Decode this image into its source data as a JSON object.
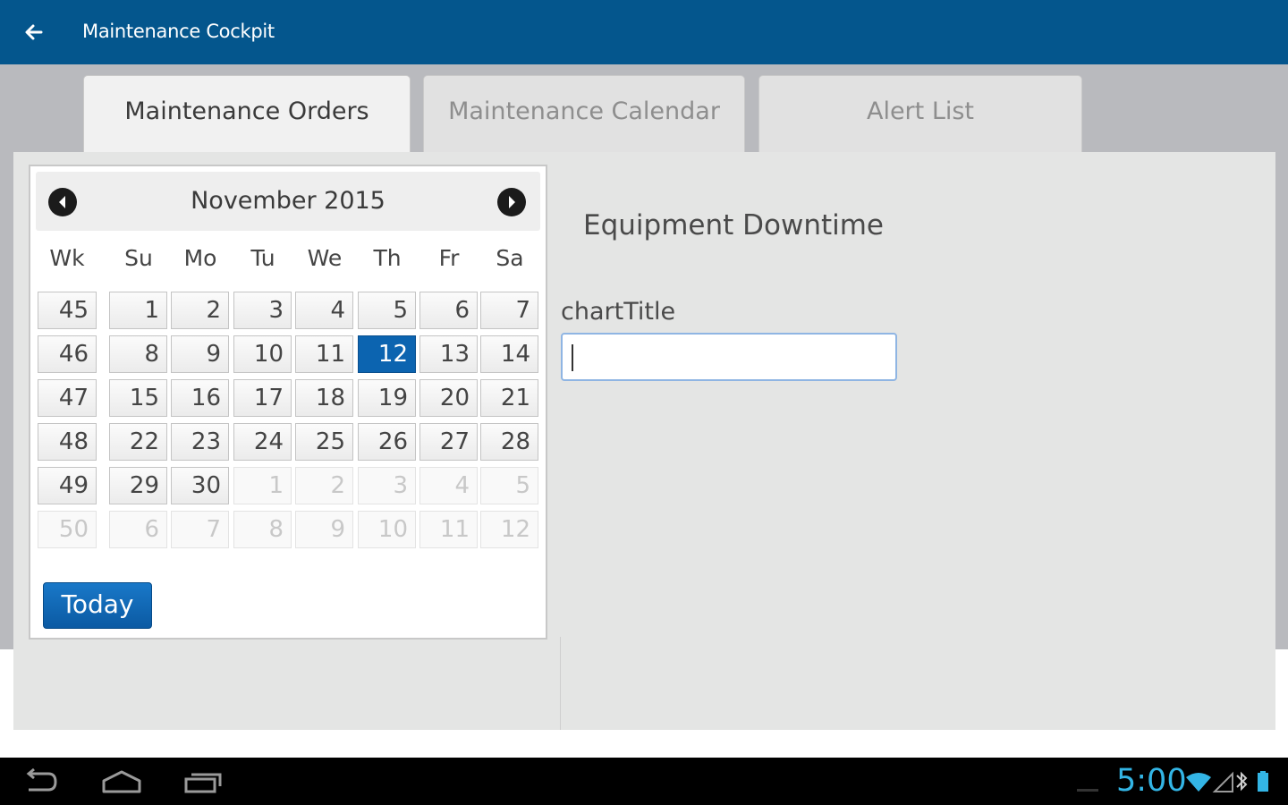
{
  "app": {
    "title": "Maintenance Cockpit"
  },
  "tabs": [
    {
      "label": "Maintenance Orders",
      "active": true
    },
    {
      "label": "Maintenance Calendar",
      "active": false
    },
    {
      "label": "Alert List",
      "active": false
    }
  ],
  "calendar": {
    "month_label": "November 2015",
    "weekdays": [
      "Wk",
      "Su",
      "Mo",
      "Tu",
      "We",
      "Th",
      "Fr",
      "Sa"
    ],
    "weeks": [
      {
        "wk": "45",
        "days": [
          "1",
          "2",
          "3",
          "4",
          "5",
          "6",
          "7"
        ]
      },
      {
        "wk": "46",
        "days": [
          "8",
          "9",
          "10",
          "11",
          "12",
          "13",
          "14"
        ]
      },
      {
        "wk": "47",
        "days": [
          "15",
          "16",
          "17",
          "18",
          "19",
          "20",
          "21"
        ]
      },
      {
        "wk": "48",
        "days": [
          "22",
          "23",
          "24",
          "25",
          "26",
          "27",
          "28"
        ]
      },
      {
        "wk": "49",
        "days": [
          "29",
          "30",
          "1",
          "2",
          "3",
          "4",
          "5"
        ]
      },
      {
        "wk": "50",
        "days": [
          "6",
          "7",
          "8",
          "9",
          "10",
          "11",
          "12"
        ]
      }
    ],
    "selected_day": "12",
    "today_label": "Today"
  },
  "panel": {
    "title": "Equipment Downtime",
    "field_label": "chartTitle",
    "field_value": ""
  },
  "system_bar": {
    "time": "5:00"
  },
  "colors": {
    "appbar": "#04568d",
    "selected": "#0c64b0",
    "clock": "#33b5e5"
  }
}
